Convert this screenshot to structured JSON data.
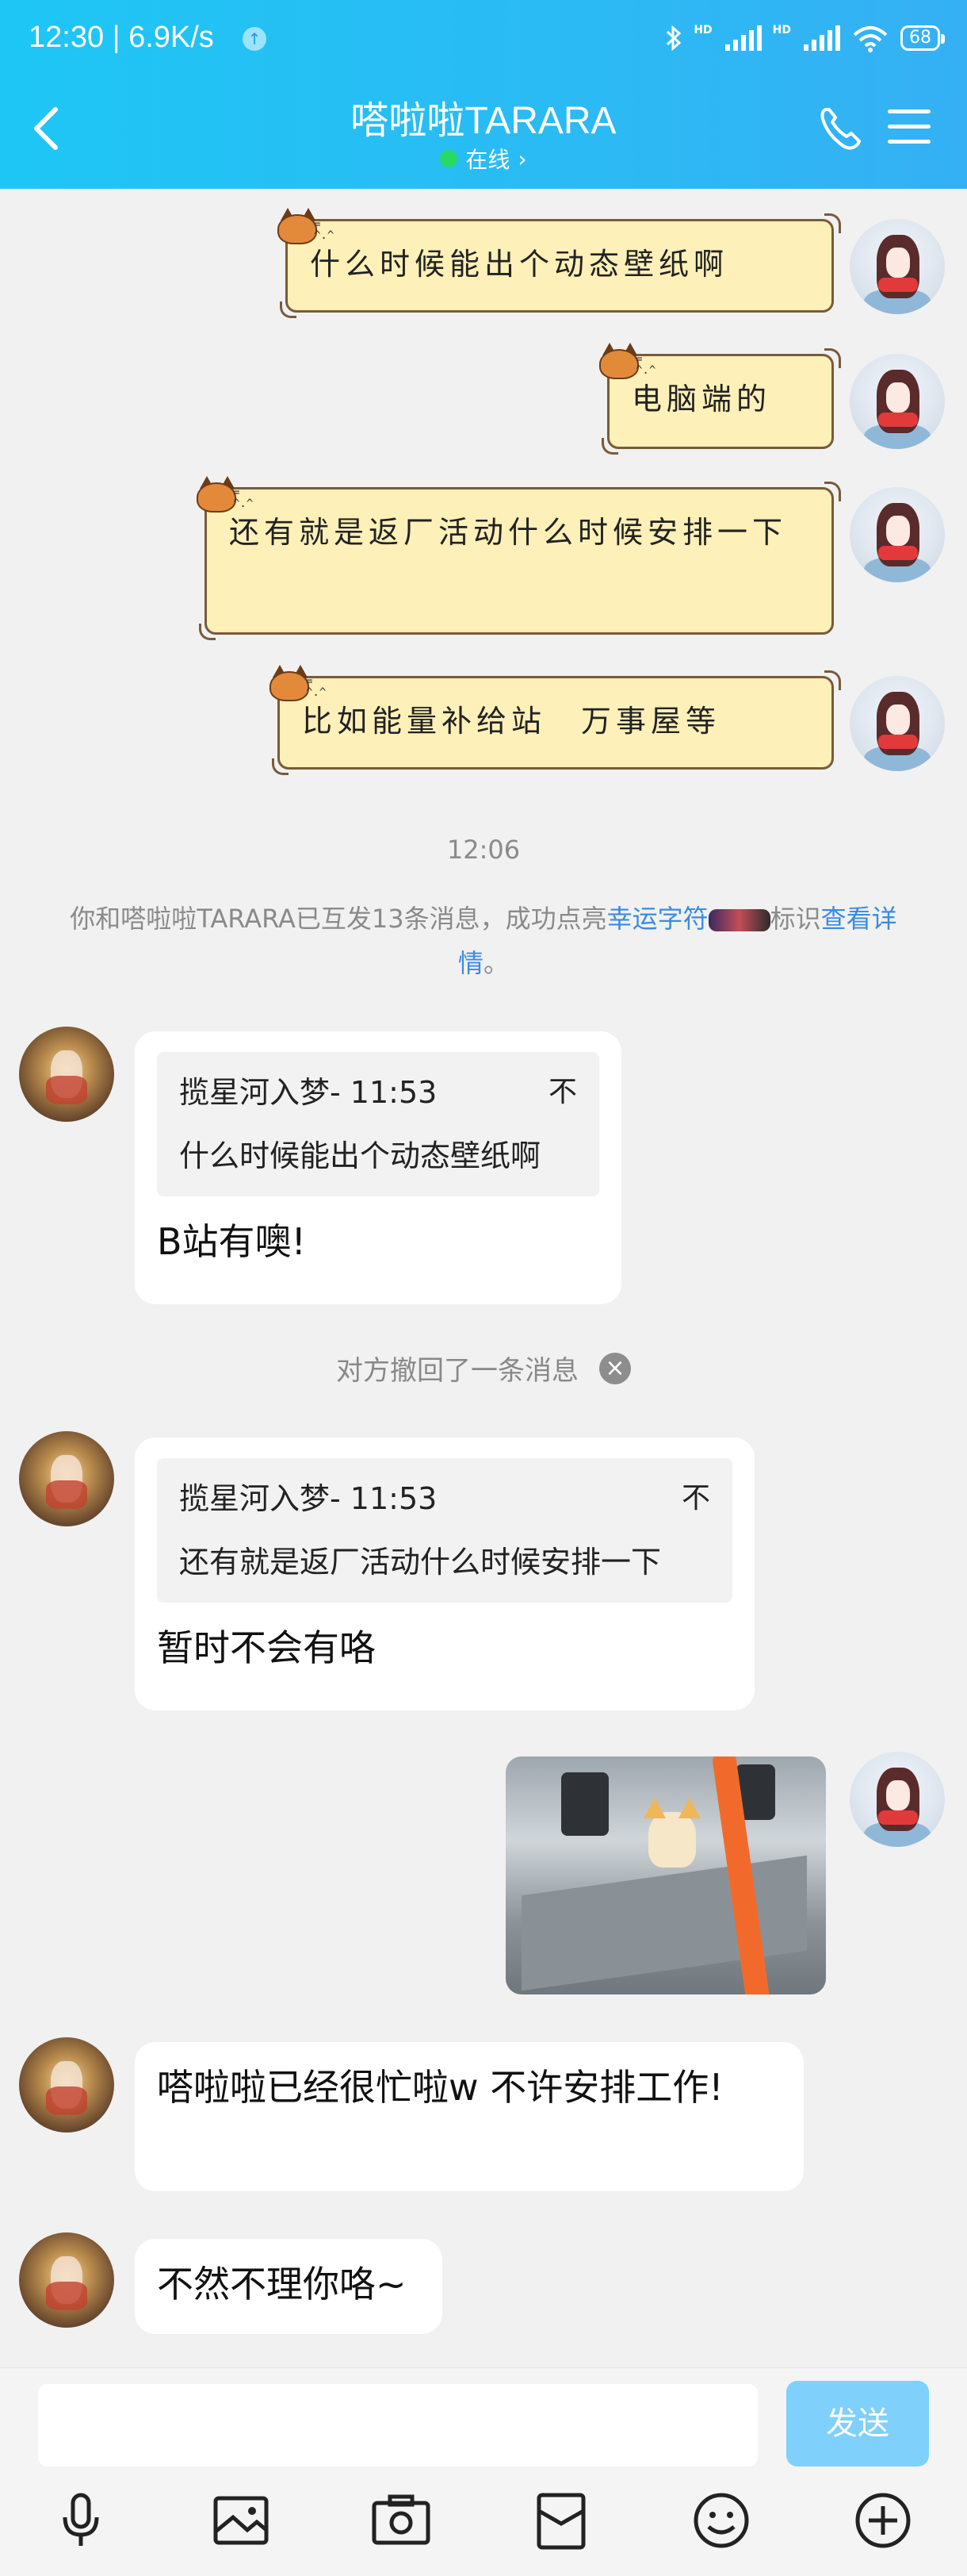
{
  "status_bar": {
    "time": "12:30 | 6.9K/s",
    "upload_glyph": "↑",
    "hd1": "HD",
    "hd2": "HD",
    "battery": "68",
    "icons": [
      "bluetooth-icon",
      "signal-icon",
      "signal-icon",
      "wifi-icon",
      "battery-icon"
    ]
  },
  "header": {
    "title": "嗒啦啦TARARA",
    "status": "在线",
    "status_chevron": "›",
    "icons": [
      "back-icon",
      "phone-icon",
      "menu-icon"
    ]
  },
  "messages_sent": [
    {
      "text": "什么时候能出个动态壁纸啊"
    },
    {
      "text": "电脑端的"
    },
    {
      "text": "还有就是返厂活动什么时候安排一下"
    },
    {
      "text": "比如能量补给站　万事屋等"
    }
  ],
  "cat_whiskers": "=\n^.^",
  "timestamp": "12:06",
  "system_message": {
    "part1": "你和嗒啦啦TARARA已互发13条消息，成功点亮",
    "link1": "幸运字符",
    "badge": "",
    "part2": "标识",
    "link2": "查看详情",
    "end": "。"
  },
  "replies": [
    {
      "quote_sender": "揽星河入梦- 11:53",
      "quote_text": "什么时候能出个动态壁纸啊",
      "quote_icon": "不",
      "text": "B站有噢!"
    },
    {
      "quote_sender": "揽星河入梦- 11:53",
      "quote_text": "还有就是返厂活动什么时候安排一下",
      "quote_icon": "不",
      "text": "暂时不会有咯"
    },
    {
      "text": "嗒啦啦已经很忙啦w 不许安排工作!"
    },
    {
      "text": "不然不理你咯~"
    }
  ],
  "recall_notice": "对方撤回了一条消息",
  "recall_close": "×",
  "input": {
    "placeholder": "",
    "send_label": "发送"
  },
  "toolbar_icons": [
    "microphone-icon",
    "image-icon",
    "camera-icon",
    "red-packet-icon",
    "emoji-icon",
    "plus-icon"
  ]
}
